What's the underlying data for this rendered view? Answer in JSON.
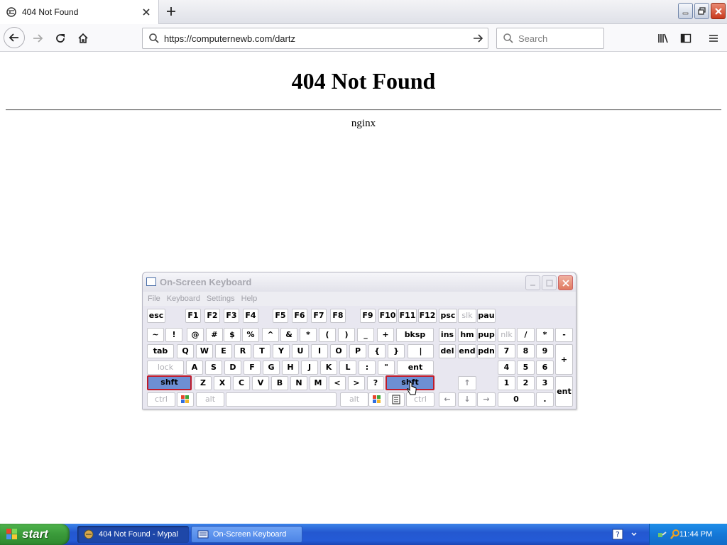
{
  "browser": {
    "tab_title": "404 Not Found",
    "url": "https://computernewb.com/dartz",
    "search_placeholder": "Search"
  },
  "page": {
    "heading": "404 Not Found",
    "server": "nginx"
  },
  "osk": {
    "title": "On-Screen Keyboard",
    "menu": [
      "File",
      "Keyboard",
      "Settings",
      "Help"
    ],
    "rows": {
      "fn": [
        "esc",
        "F1",
        "F2",
        "F3",
        "F4",
        "F5",
        "F6",
        "F7",
        "F8",
        "F9",
        "F10",
        "F11",
        "F12",
        "psc",
        "slk",
        "pau"
      ],
      "num": [
        "~",
        "!",
        "@",
        "#",
        "$",
        "%",
        "^",
        "&",
        "*",
        "(",
        ")",
        "_",
        "+",
        "bksp",
        "ins",
        "hm",
        "pup",
        "nlk",
        "/",
        "*",
        "-"
      ],
      "top": [
        "tab",
        "Q",
        "W",
        "E",
        "R",
        "T",
        "Y",
        "U",
        "I",
        "O",
        "P",
        "{",
        "}",
        "|",
        "del",
        "end",
        "pdn",
        "7",
        "8",
        "9",
        "+"
      ],
      "home": [
        "lock",
        "A",
        "S",
        "D",
        "F",
        "G",
        "H",
        "J",
        "K",
        "L",
        ":",
        "\"",
        "ent",
        "4",
        "5",
        "6"
      ],
      "bottom": [
        "shft",
        "Z",
        "X",
        "C",
        "V",
        "B",
        "N",
        "M",
        "<",
        ">",
        "?",
        "shft",
        "↑",
        "1",
        "2",
        "3",
        "ent"
      ],
      "space": [
        "ctrl",
        "alt",
        "alt",
        "ctrl",
        "←",
        "↓",
        "→",
        "0",
        "."
      ]
    }
  },
  "taskbar": {
    "start_label": "start",
    "tasks": [
      "404 Not Found - Mypal",
      "On-Screen Keyboard"
    ],
    "clock": "11:44 PM"
  }
}
